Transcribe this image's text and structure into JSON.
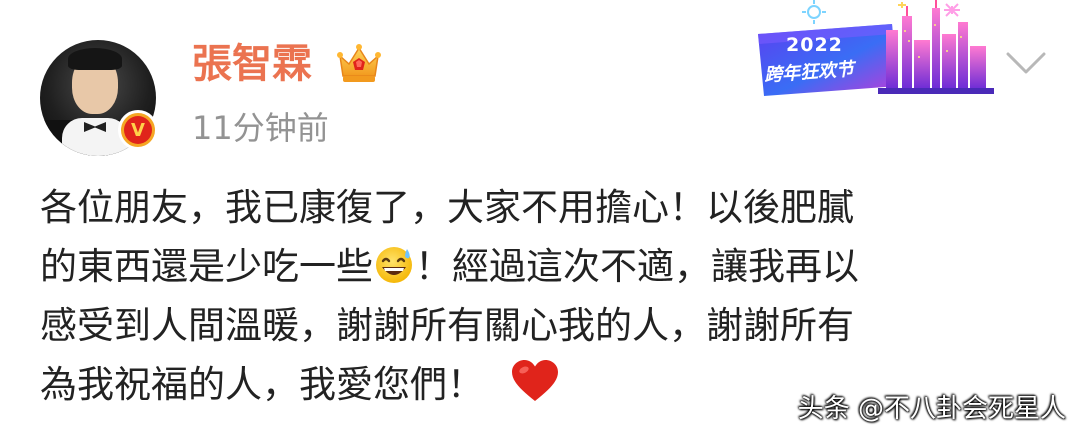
{
  "post": {
    "author": {
      "name": "張智霖",
      "verified": true,
      "badge_color": "#f5a623",
      "vip_icon": "crown-icon"
    },
    "timestamp": "11分钟前",
    "banner": {
      "year": "2022",
      "name": "跨年狂欢节"
    },
    "expand_icon": "chevron-down-icon",
    "body_lines": [
      "各位朋友，我已康復了，大家不用擔心！以後肥膩",
      "的東西還是少吃一些",
      "！經過這次不適，讓我再以",
      "感受到人間溫暖，謝謝所有關心我的人，謝謝所有",
      "為我祝福的人，我愛您們！"
    ],
    "emojis": [
      "grinning-sweat-emoji",
      "red-heart-emoji"
    ]
  },
  "watermark": "头条 @不八卦会死星人",
  "colors": {
    "username": "#eb7350",
    "timestamp": "#939393",
    "text": "#222222",
    "heart": "#e0241b"
  }
}
